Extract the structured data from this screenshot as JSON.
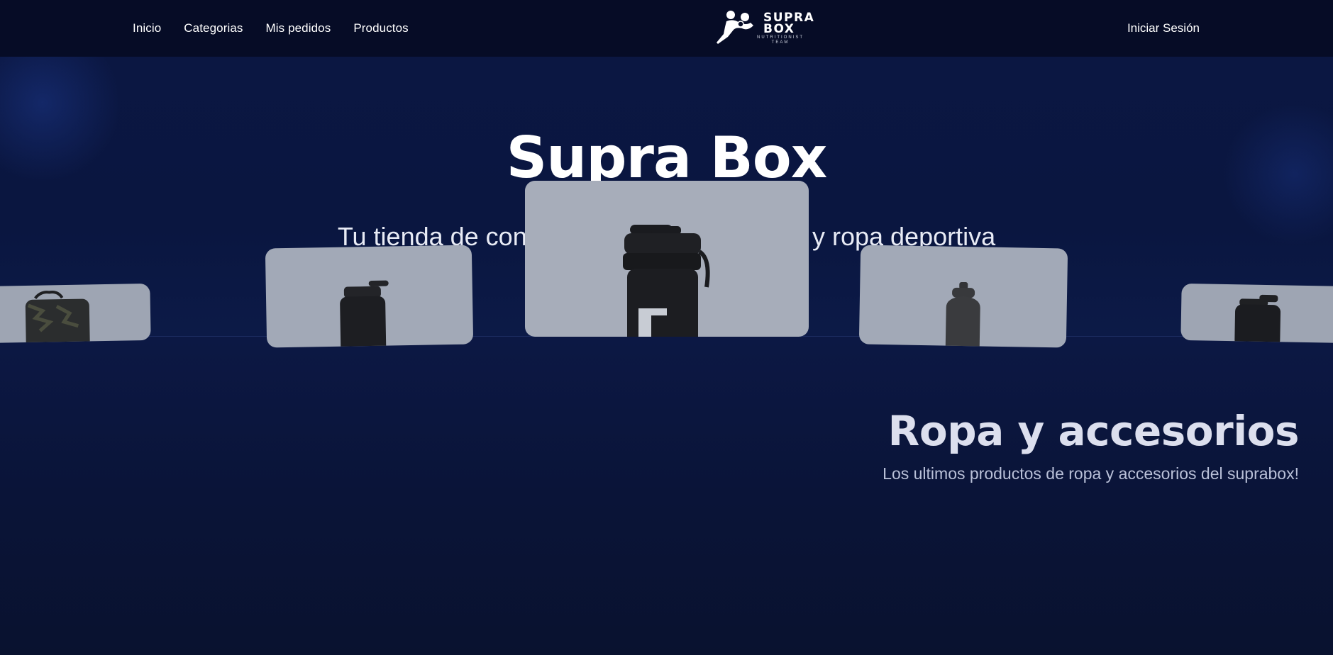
{
  "nav": {
    "links": [
      "Inicio",
      "Categorias",
      "Mis pedidos",
      "Productos"
    ],
    "login": "Iniciar Sesión"
  },
  "logo": {
    "line1": "SUPRA",
    "line2": "BOX",
    "tagline1": "NUTRITIONIST",
    "tagline2": "TEAM"
  },
  "hero": {
    "title": "Supra Box",
    "subtitle": "Tu tienda de confianza para suplementos y ropa deportiva"
  },
  "section": {
    "title": "Ropa y accesorios",
    "subtitle": "Los ultimos productos de ropa y accesorios del suprabox!"
  },
  "colors": {
    "navbar": "#060c26",
    "hero_bg": "#0b1742",
    "card_bg": "#a2a9b7"
  }
}
